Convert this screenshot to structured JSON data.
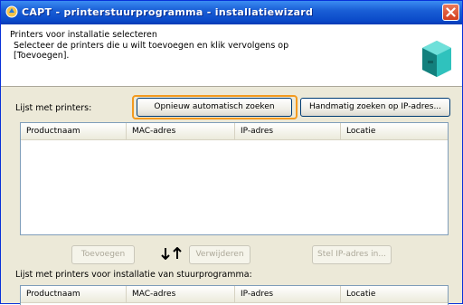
{
  "window": {
    "title": "CAPT - printerstuurprogramma - installatiewizard",
    "brand_color": "#0a49c8",
    "close_color": "#d43e1d"
  },
  "header": {
    "title": "Printers voor installatie selecteren",
    "description": "Selecteer de printers die u wilt toevoegen en klik vervolgens op [Toevoegen]."
  },
  "printer_list": {
    "label": "Lijst met printers:",
    "rescan_button": "Opnieuw automatisch zoeken",
    "manual_search_button": "Handmatig zoeken op IP-adres...",
    "columns": [
      "Productnaam",
      "MAC-adres",
      "IP-adres",
      "Locatie"
    ],
    "rows": []
  },
  "actions": {
    "add_button": "Toevoegen",
    "remove_button": "Verwijderen",
    "set_ip_button": "Stel IP-adres in..."
  },
  "install_list": {
    "label": "Lijst met printers voor installatie van stuurprogramma:",
    "columns": [
      "Productnaam",
      "MAC-adres",
      "IP-adres",
      "Locatie"
    ],
    "rows": []
  },
  "highlight_color": "#f39a1e"
}
